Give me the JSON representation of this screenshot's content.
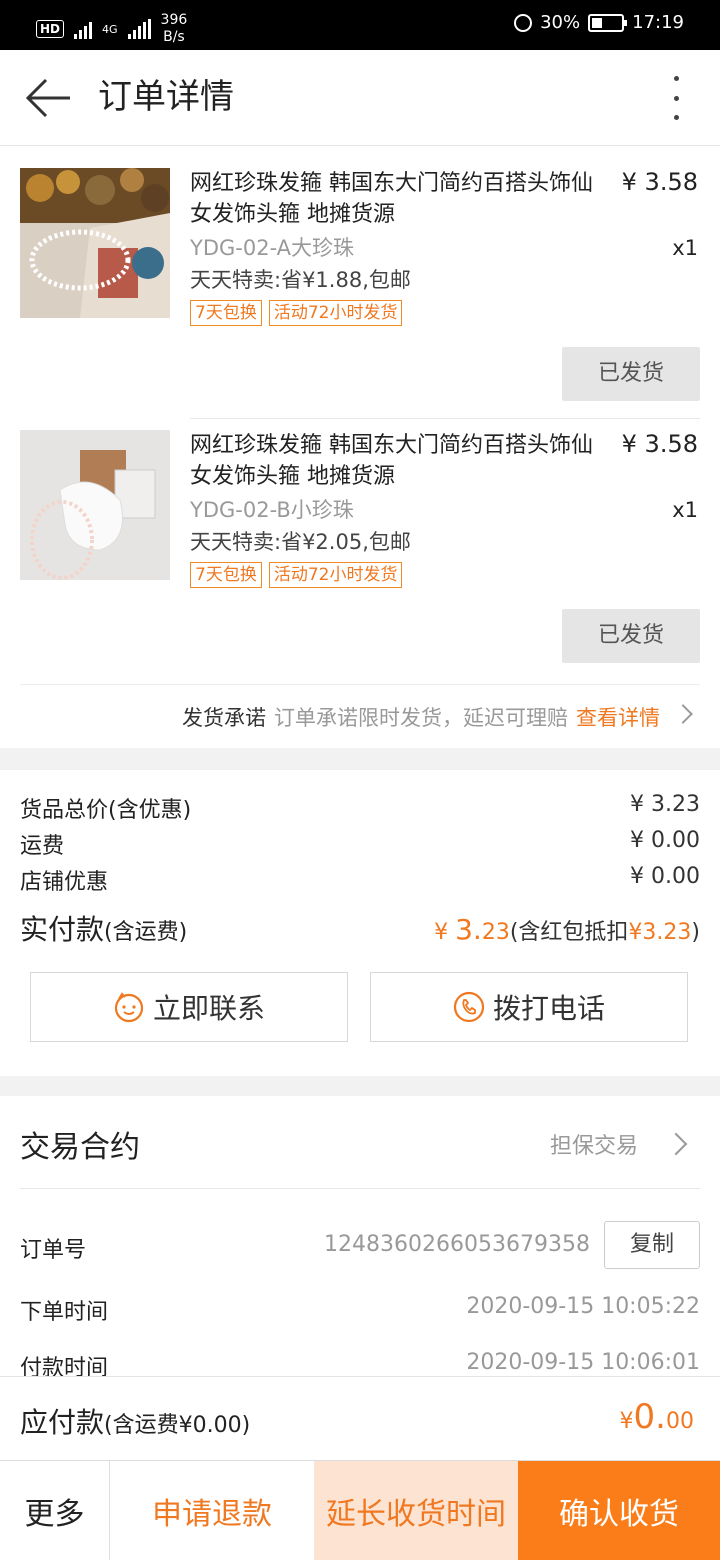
{
  "status_bar": {
    "net_speed": "396",
    "net_unit": "B/s",
    "battery": "30%",
    "time": "17:19",
    "network": "4G"
  },
  "header": {
    "title": "订单详情"
  },
  "items": [
    {
      "name": "网红珍珠发箍 韩国东大门简约百搭头饰仙女发饰头箍 地摊货源",
      "price": "¥ 3.58",
      "sku": "YDG-02-A大珍珠",
      "qty": "x1",
      "promo": "天天特卖:省¥1.88,包邮",
      "tags": [
        "7天包换",
        "活动72小时发货"
      ],
      "status": "已发货"
    },
    {
      "name": "网红珍珠发箍 韩国东大门简约百搭头饰仙女发饰头箍 地摊货源",
      "price": "¥ 3.58",
      "sku": "YDG-02-B小珍珠",
      "qty": "x1",
      "promo": "天天特卖:省¥2.05,包邮",
      "tags": [
        "7天包换",
        "活动72小时发货"
      ],
      "status": "已发货"
    }
  ],
  "promise": {
    "label": "发货承诺",
    "desc": "订单承诺限时发货，延迟可理赔",
    "link": "查看详情"
  },
  "summary": {
    "rows": [
      {
        "label": "货品总价(含优惠)",
        "value": "¥ 3.23"
      },
      {
        "label": "运费",
        "value": "¥ 0.00"
      },
      {
        "label": "店铺优惠",
        "value": "¥ 0.00"
      }
    ],
    "paid_label": "实付款",
    "paid_sub": "(含运费)",
    "paid_symbol": "¥ ",
    "paid_int": "3.",
    "paid_dec": "23",
    "paid_note_pre": "(含红包抵扣",
    "paid_note_val": "¥3.23",
    "paid_note_post": ")"
  },
  "contact": {
    "chat_label": "立即联系",
    "call_label": "拨打电话"
  },
  "contract": {
    "title": "交易合约",
    "type": "担保交易",
    "order_no_label": "订单号",
    "order_no": "1248360266053679358",
    "copy_label": "复制",
    "order_time_label": "下单时间",
    "order_time": "2020-09-15 10:05:22",
    "pay_time_label": "付款时间",
    "pay_time": "2020-09-15 10:06:01"
  },
  "payable": {
    "label": "应付款",
    "sub": "(含运费¥0.00)",
    "symbol": "¥",
    "int": "0.",
    "dec": "00"
  },
  "actions": {
    "more": "更多",
    "refund": "申请退款",
    "extend": "延长收货时间",
    "confirm": "确认收货"
  },
  "colors": {
    "accent": "#f07820",
    "confirm_bg": "#fa7d19",
    "extend_bg": "#fde3d2"
  }
}
